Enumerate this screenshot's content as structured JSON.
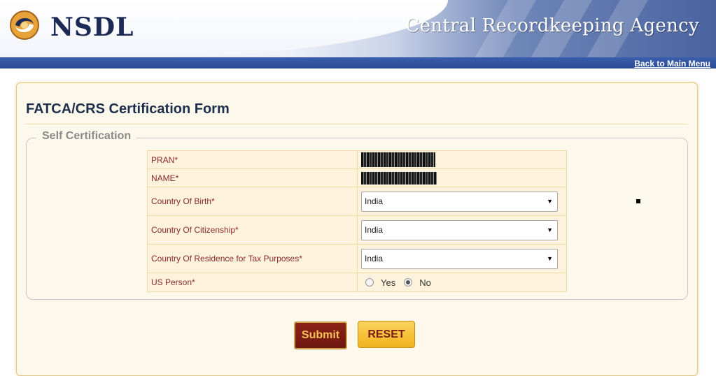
{
  "header": {
    "logo_text": "NSDL",
    "agency_name": "Central Recordkeeping Agency",
    "back_link": "Back to Main Menu"
  },
  "form": {
    "title": "FATCA/CRS Certification Form",
    "section_legend": "Self Certification",
    "fields": {
      "pran_label": "PRAN*",
      "name_label": "NAME*",
      "country_birth_label": "Country Of Birth*",
      "country_birth_value": "India",
      "country_citizenship_label": "Country Of Citizenship*",
      "country_citizenship_value": "India",
      "country_residence_label": "Country Of Residence for Tax Purposes*",
      "country_residence_value": "India",
      "us_person_label": "US Person*",
      "us_person_yes": "Yes",
      "us_person_no": "No",
      "us_person_selected": "No"
    },
    "buttons": {
      "submit": "Submit",
      "reset": "RESET"
    }
  },
  "colors": {
    "card_bg": "#fdf8ec",
    "label_text": "#8b2a2a",
    "submit_bg": "#7a1c12",
    "reset_bg": "#f4bd2c",
    "header_blue": "#2b4a93"
  }
}
